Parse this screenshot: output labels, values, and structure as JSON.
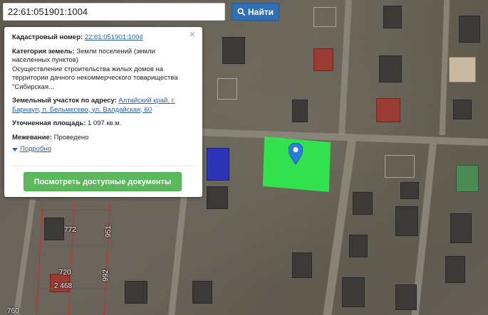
{
  "search": {
    "value": "22:61:051901:1004",
    "button_label": "Найти"
  },
  "popup": {
    "cadastral": {
      "label": "Кадастровый номер:",
      "value": "22:61:051901:1004"
    },
    "category": {
      "label": "Категория земель:",
      "value": "Земли поселений (земли населенных пунктов)"
    },
    "description": "Осуществление строительства жилых домов на территории дачного некоммерческого товарищества \"Сибирская...",
    "address": {
      "label": "Земельный участок по адресу:",
      "value": "Алтайский край, г. Барнаул, п. Бельмесево, ул. Валдайская, 60"
    },
    "area": {
      "label": "Уточненная площадь:",
      "value": "1 097 кв.м."
    },
    "survey": {
      "label": "Межевание:",
      "value": "Проведено"
    },
    "more_label": "Подробно",
    "docs_button": "Посмотреть доступные документы",
    "close_symbol": "×"
  },
  "map": {
    "parcel_color": "#2ee84d",
    "marker_color": "#2a7ee0",
    "cadastral_labels": [
      "772",
      "951",
      "720",
      "2 468",
      "992",
      "760"
    ]
  },
  "icons": {
    "search_button": "search-icon",
    "close": "close-icon",
    "more": "caret-down-icon",
    "marker": "map-pin-icon"
  }
}
